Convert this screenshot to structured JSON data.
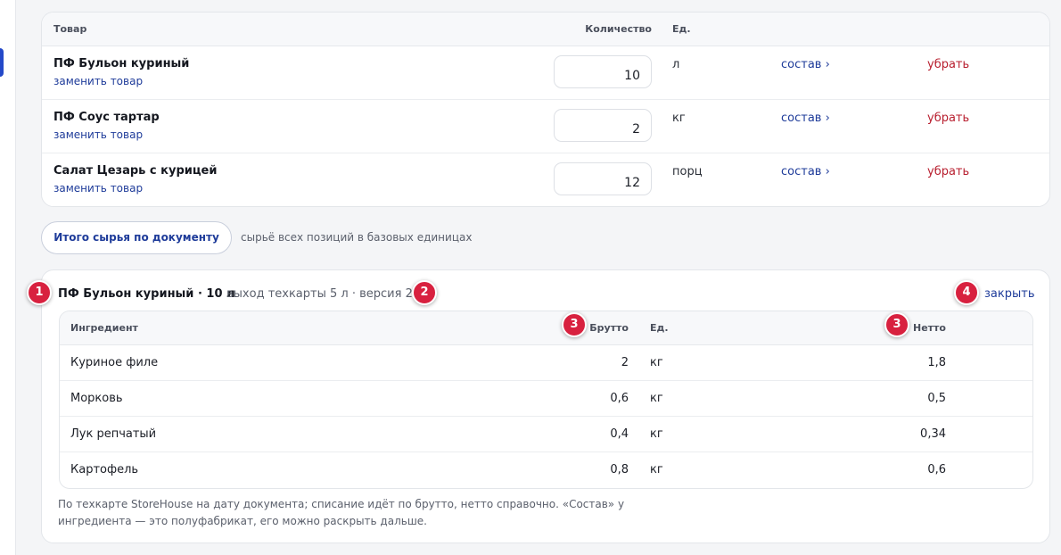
{
  "items": {
    "headers": {
      "product": "Товар",
      "qty": "Количество",
      "unit": "Ед."
    },
    "rows": [
      {
        "name": "ПФ Бульон куриный",
        "replace": "заменить товар",
        "qty": "10",
        "unit": "л",
        "compose": "состав ›",
        "remove": "убрать"
      },
      {
        "name": "ПФ Соус тартар",
        "replace": "заменить товар",
        "qty": "2",
        "unit": "кг",
        "compose": "состав ›",
        "remove": "убрать"
      },
      {
        "name": "Салат Цезарь с курицей",
        "replace": "заменить товар",
        "qty": "12",
        "unit": "порц",
        "compose": "состав ›",
        "remove": "убрать"
      }
    ]
  },
  "totals": {
    "button_label": "Итого сырья по документу",
    "hint": "сырьё всех позиций в базовых единицах"
  },
  "recipe": {
    "title": "ПФ Бульон куриный · 10 л",
    "meta": "выход техкарты  5 л · версия 2",
    "close_label": "закрыть",
    "headers": {
      "name": "Ингредиент",
      "brutto": "Брутто",
      "unit": "Ед.",
      "netto": "Нетто"
    },
    "rows": [
      {
        "name": "Куриное филе",
        "brutto": "2",
        "unit": "кг",
        "netto": "1,8"
      },
      {
        "name": "Морковь",
        "brutto": "0,6",
        "unit": "кг",
        "netto": "0,5"
      },
      {
        "name": "Лук репчатый",
        "brutto": "0,4",
        "unit": "кг",
        "netto": "0,34"
      },
      {
        "name": "Картофель",
        "brutto": "0,8",
        "unit": "кг",
        "netto": "0,6"
      }
    ],
    "note": "По техкарте StoreHouse на дату документа; списание идёт по брутто, нетто справочно. «Состав» у ингредиента — это полуфабрикат, его можно раскрыть дальше."
  },
  "markers": [
    "1",
    "2",
    "3",
    "3",
    "4"
  ],
  "colors": {
    "accent": "#1f3c9a",
    "danger": "#b81f2f",
    "marker": "#d8213f"
  }
}
